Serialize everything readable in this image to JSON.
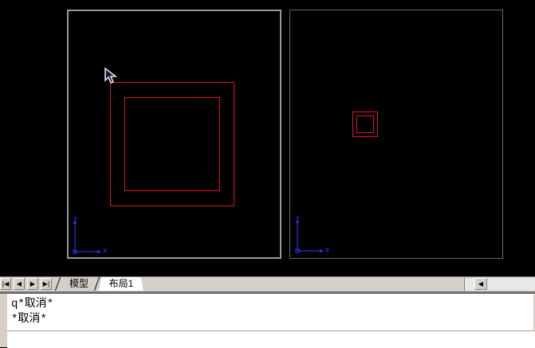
{
  "colors": {
    "canvas_bg": "#000000",
    "geometry": "#e0141e",
    "ucs": "#2a3cff",
    "viewport_active_border": "#9a9a9a",
    "viewport_border": "#6a6a6a"
  },
  "viewports": {
    "left": {
      "ucs_x": "X",
      "ucs_y": "Y",
      "active": true
    },
    "right": {
      "ucs_x": "X",
      "ucs_y": "Y",
      "active": false
    }
  },
  "tabs": {
    "model": "模型",
    "layout1": "布局1"
  },
  "nav_icons": [
    "first-tab-icon",
    "prev-tab-icon",
    "next-tab-icon",
    "last-tab-icon"
  ],
  "command_history": {
    "line1": "q*取消*",
    "line2": "*取消*"
  },
  "command_input": {
    "value": ""
  }
}
